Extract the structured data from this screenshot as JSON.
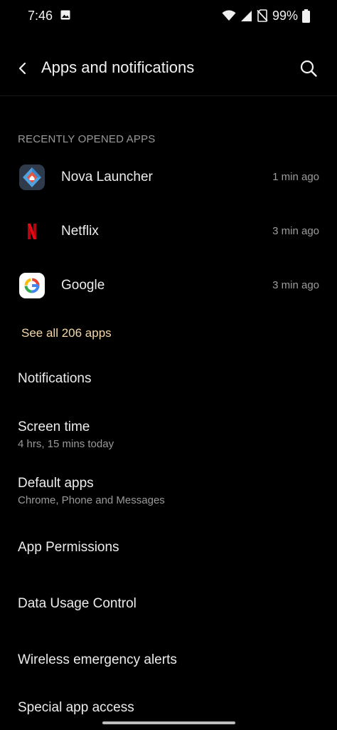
{
  "status_bar": {
    "time": "7:46",
    "battery_percent": "99%"
  },
  "header": {
    "title": "Apps and notifications"
  },
  "recent_apps": {
    "section_label": "RECENTLY OPENED APPS",
    "items": [
      {
        "name": "Nova Launcher",
        "time": "1 min ago",
        "icon": "nova-launcher-icon"
      },
      {
        "name": "Netflix",
        "time": "3 min ago",
        "icon": "netflix-icon"
      },
      {
        "name": "Google",
        "time": "3 min ago",
        "icon": "google-icon"
      }
    ],
    "see_all_label": "See all 206 apps"
  },
  "menu": {
    "notifications": {
      "title": "Notifications"
    },
    "screen_time": {
      "title": "Screen time",
      "subtitle": "4 hrs, 15 mins today"
    },
    "default_apps": {
      "title": "Default apps",
      "subtitle": "Chrome, Phone and Messages"
    },
    "app_permissions": {
      "title": "App Permissions"
    },
    "data_usage_control": {
      "title": "Data Usage Control"
    },
    "wireless_emergency_alerts": {
      "title": "Wireless emergency alerts"
    },
    "special_app_access": {
      "title": "Special app access"
    }
  },
  "colors": {
    "background": "#000000",
    "accent": "#f4d7a8",
    "primary_text": "#ececec",
    "secondary_text": "#9a9a9a"
  }
}
